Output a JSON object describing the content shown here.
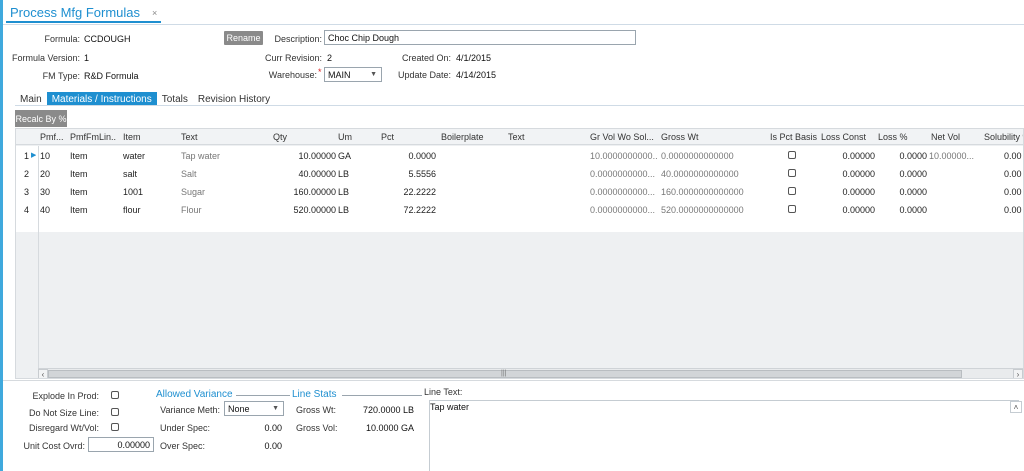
{
  "window": {
    "tab_title": "Process Mfg Formulas",
    "close_glyph": "×"
  },
  "header": {
    "formula_label": "Formula:",
    "formula_value": "CCDOUGH",
    "rename_label": "Rename",
    "description_label": "Description:",
    "description_value": "Choc Chip Dough",
    "formula_version_label": "Formula Version:",
    "formula_version_value": "1",
    "curr_revision_label": "Curr Revision:",
    "curr_revision_value": "2",
    "created_on_label": "Created On:",
    "created_on_value": "4/1/2015",
    "fm_type_label": "FM Type:",
    "fm_type_value": "R&D Formula",
    "warehouse_label": "Warehouse:",
    "warehouse_required": "*",
    "warehouse_value": "MAIN",
    "update_date_label": "Update Date:",
    "update_date_value": "4/14/2015"
  },
  "subtabs": [
    "Main",
    "Materials / Instructions",
    "Totals",
    "Revision History"
  ],
  "toolbar": {
    "recalc_label": "Recalc By %"
  },
  "grid": {
    "columns": [
      "Pmf...",
      "PmfFmLin...",
      "Item",
      "Text",
      "Qty",
      "Um",
      "Pct",
      "Boilerplate",
      "Text",
      "Gr Vol Wo Sol...",
      "Gross Wt",
      "Is Pct Basis",
      "Loss Const",
      "Loss %",
      "Net Vol",
      "Solubility %"
    ],
    "rows": [
      {
        "num": "1",
        "pmf": "10",
        "line": "Item",
        "item": "water",
        "text": "Tap water",
        "qty": "10.00000",
        "um": "GA",
        "pct": "0.0000",
        "gr_vol": "10.0000000000...",
        "gross_wt": "0.0000000000000",
        "loss_const": "0.00000",
        "loss_pct": "0.0000",
        "net_vol": "10.00000...",
        "sol": "0.00"
      },
      {
        "num": "2",
        "pmf": "20",
        "line": "Item",
        "item": "salt",
        "text": "Salt",
        "qty": "40.00000",
        "um": "LB",
        "pct": "5.5556",
        "gr_vol": "0.0000000000...",
        "gross_wt": "40.0000000000000",
        "loss_const": "0.00000",
        "loss_pct": "0.0000",
        "net_vol": "",
        "sol": "0.00"
      },
      {
        "num": "3",
        "pmf": "30",
        "line": "Item",
        "item": "1001",
        "text": "Sugar",
        "qty": "160.00000",
        "um": "LB",
        "pct": "22.2222",
        "gr_vol": "0.0000000000...",
        "gross_wt": "160.0000000000000",
        "loss_const": "0.00000",
        "loss_pct": "0.0000",
        "net_vol": "",
        "sol": "0.00"
      },
      {
        "num": "4",
        "pmf": "40",
        "line": "Item",
        "item": "flour",
        "text": "Flour",
        "qty": "520.00000",
        "um": "LB",
        "pct": "72.2222",
        "gr_vol": "0.0000000000...",
        "gross_wt": "520.0000000000000",
        "loss_const": "0.00000",
        "loss_pct": "0.0000",
        "net_vol": "",
        "sol": "0.00"
      }
    ]
  },
  "bottom": {
    "explode_label": "Explode In Prod:",
    "do_not_size_label": "Do Not Size Line:",
    "disregard_label": "Disregard Wt/Vol:",
    "unit_cost_label": "Unit Cost Ovrd:",
    "unit_cost_value": "0.00000",
    "allowed_variance_title": "Allowed Variance",
    "variance_meth_label": "Variance Meth:",
    "variance_meth_value": "None",
    "under_spec_label": "Under Spec:",
    "under_spec_value": "0.00",
    "over_spec_label": "Over Spec:",
    "over_spec_value": "0.00",
    "line_stats_title": "Line Stats",
    "gross_wt_label": "Gross Wt:",
    "gross_wt_value": "720.0000 LB",
    "gross_vol_label": "Gross Vol:",
    "gross_vol_value": "10.0000 GA",
    "line_text_label": "Line Text:",
    "line_text_value": "Tap water"
  },
  "icons": {
    "row_pointer": "row-pointer-icon",
    "dropdown": "chevron-down-icon",
    "scroll_left": "chevron-left-icon",
    "scroll_right": "chevron-right-icon",
    "scroll_up": "chevron-up-icon",
    "scroll_grip": "scroll-grip-icon"
  },
  "colors": {
    "accent": "#1e8fd0",
    "button_gray": "#8a8a8a"
  }
}
